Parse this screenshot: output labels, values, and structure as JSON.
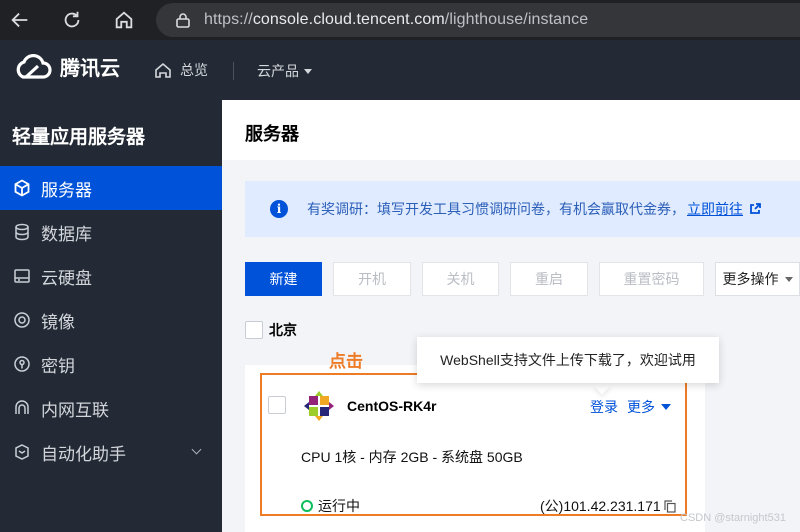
{
  "browser": {
    "url_prefix": "https://",
    "url_host": "console.cloud.tencent.com",
    "url_path": "/lighthouse/instance"
  },
  "header": {
    "brand": "腾讯云",
    "home_label": "总览",
    "products_label": "云产品"
  },
  "sidebar": {
    "title": "轻量应用服务器",
    "items": [
      {
        "label": "服务器",
        "icon": "cube-icon",
        "active": true
      },
      {
        "label": "数据库",
        "icon": "database-icon"
      },
      {
        "label": "云硬盘",
        "icon": "disk-icon"
      },
      {
        "label": "镜像",
        "icon": "image-icon"
      },
      {
        "label": "密钥",
        "icon": "key-icon"
      },
      {
        "label": "内网互联",
        "icon": "link-icon"
      },
      {
        "label": "自动化助手",
        "icon": "assistant-icon"
      }
    ]
  },
  "main": {
    "title": "服务器",
    "notice": {
      "text": "有奖调研：填写开发工具习惯调研问卷，有机会赢取代金券，",
      "link": "立即前往"
    },
    "toolbar": {
      "new": "新建",
      "start": "开机",
      "stop": "关机",
      "restart": "重启",
      "reset_password": "重置密码",
      "more_ops": "更多操作"
    },
    "region": "北京",
    "annotation": "点击",
    "tooltip": "WebShell支持文件上传下载了，欢迎试用",
    "instance": {
      "name": "CentOS-RK4r",
      "login": "登录",
      "more": "更多",
      "spec": "CPU 1核 - 内存 2GB - 系统盘 50GB",
      "status": "运行中",
      "ip": "(公)101.42.231.171"
    }
  },
  "watermark": "CSDN @starnight531",
  "colors": {
    "accent": "#0052d9",
    "highlight": "#ee7b26",
    "running": "#0abf5b",
    "dark_bg": "#232a35"
  }
}
